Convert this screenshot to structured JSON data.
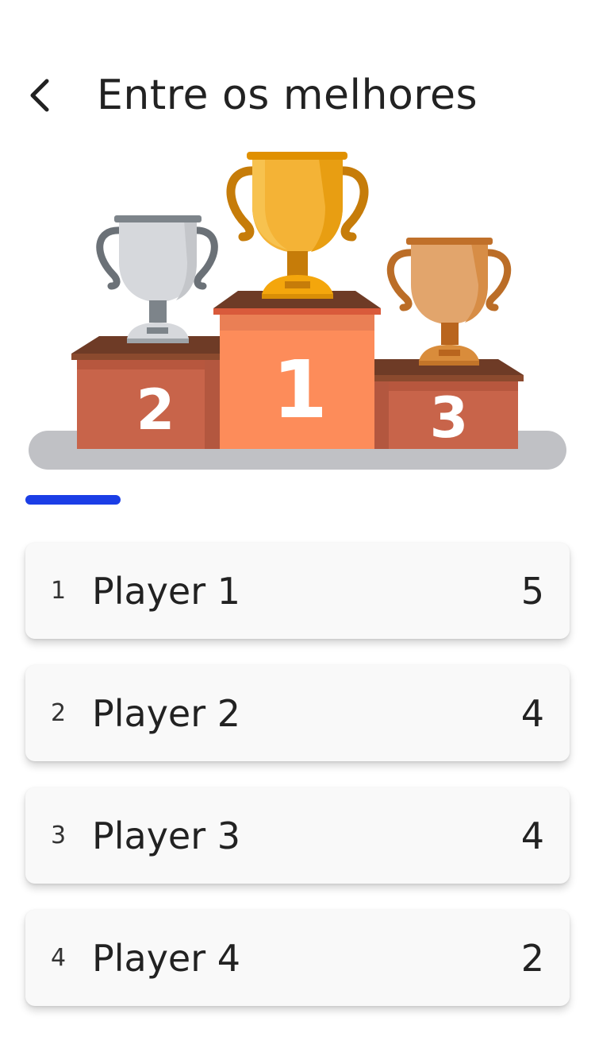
{
  "header": {
    "title": "Entre os melhores",
    "back_icon": "chevron-left-icon"
  },
  "podium": {
    "places": [
      {
        "label": "1",
        "trophy": "gold-trophy-icon"
      },
      {
        "label": "2",
        "trophy": "silver-trophy-icon"
      },
      {
        "label": "3",
        "trophy": "bronze-trophy-icon"
      }
    ]
  },
  "tabs": {
    "indicator_color": "#1b3ee6"
  },
  "ranking": [
    {
      "position": "1",
      "name": "Player 1",
      "score": "5"
    },
    {
      "position": "2",
      "name": "Player 2",
      "score": "4"
    },
    {
      "position": "3",
      "name": "Player 3",
      "score": "4"
    },
    {
      "position": "4",
      "name": "Player 4",
      "score": "2"
    }
  ]
}
